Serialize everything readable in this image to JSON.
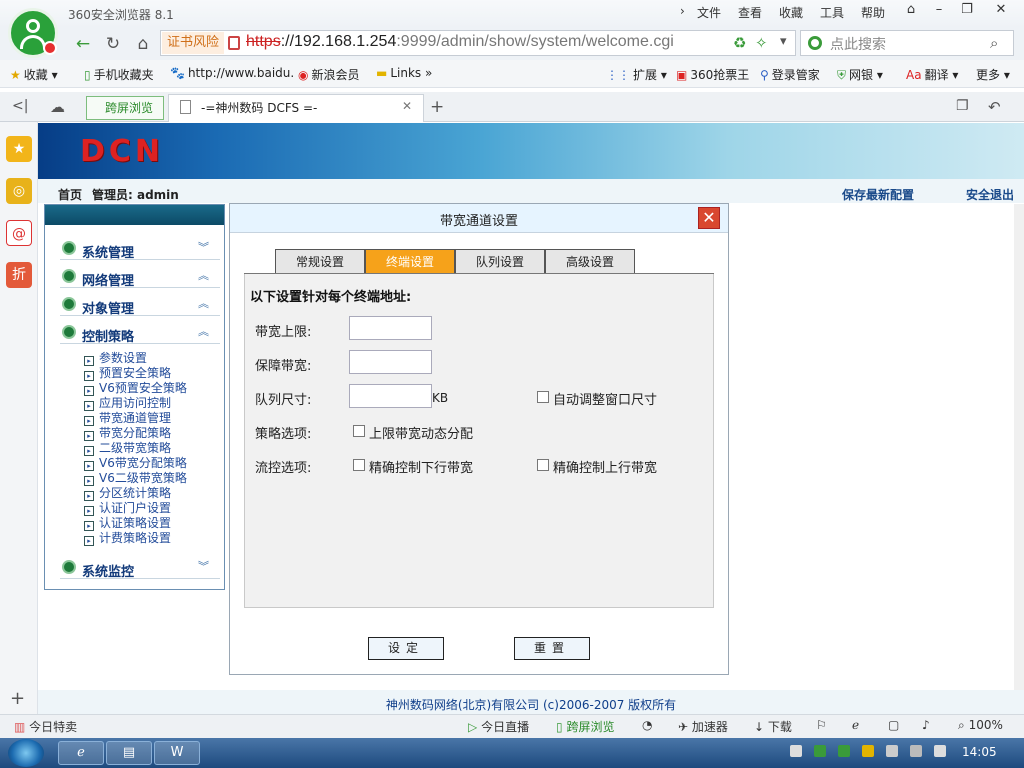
{
  "browser": {
    "app_title": "360安全浏览器 8.1",
    "menu": [
      "文件",
      "查看",
      "收藏",
      "工具",
      "帮助"
    ],
    "cert_warning": "证书风险",
    "url_scheme": "https",
    "url_host": "://192.168.1.254",
    "url_path": ":9999/admin/show/system/welcome.cgi",
    "search_placeholder": "点此搜索",
    "bookmarks": [
      "收藏",
      "手机收藏夹",
      "http://www.baidu.",
      "新浪会员",
      "Links"
    ],
    "toolbar_right": [
      "扩展",
      "360抢票王",
      "登录管家",
      "网银",
      "翻译",
      "更多"
    ],
    "tabs": {
      "split_view": "跨屏浏览",
      "active_tab": "-=神州数码 DCFS =-"
    }
  },
  "page": {
    "banner_logo": "DCN",
    "home": "首页",
    "admin_label": "管理员: admin",
    "save_config": "保存最新配置",
    "logout": "安全退出",
    "footer": "神州数码网络(北京)有限公司 (c)2006-2007 版权所有"
  },
  "sidebar": {
    "sections": [
      {
        "label": "系统管理",
        "chevron": "︾"
      },
      {
        "label": "网络管理",
        "chevron": "︽"
      },
      {
        "label": "对象管理",
        "chevron": "︽"
      },
      {
        "label": "控制策略",
        "chevron": "︽"
      }
    ],
    "items": [
      "参数设置",
      "预置安全策略",
      "V6预置安全策略",
      "应用访问控制",
      "带宽通道管理",
      "带宽分配策略",
      "二级带宽策略",
      "V6带宽分配策略",
      "V6二级带宽策略",
      "分区统计策略",
      "认证门户设置",
      "认证策略设置",
      "计费策略设置"
    ],
    "last_section": {
      "label": "系统监控",
      "chevron": "︾"
    }
  },
  "dialog": {
    "title": "带宽通道设置",
    "close": "✕",
    "tabs": [
      "常规设置",
      "终端设置",
      "队列设置",
      "高级设置"
    ],
    "active_tab": "终端设置",
    "intro": "以下设置针对每个终端地址:",
    "fields": {
      "bw_limit_label": "带宽上限:",
      "bw_guarantee_label": "保障带宽:",
      "queue_size_label": "队列尺寸:",
      "queue_unit": "KB",
      "auto_window": "自动调整窗口尺寸",
      "policy_label": "策略选项:",
      "dynamic_alloc": "上限带宽动态分配",
      "flow_label": "流控选项:",
      "precise_down": "精确控制下行带宽",
      "precise_up": "精确控制上行带宽"
    },
    "buttons": {
      "set": "设定",
      "reset": "重置"
    }
  },
  "statusbar": {
    "left": "今日特卖",
    "items": [
      "今日直播",
      "跨屏浏览",
      "加速器",
      "下载"
    ],
    "zoom": "100%"
  },
  "taskbar": {
    "clock": "14:05"
  },
  "colors": {
    "accent_tab": "#f6a21a",
    "nav_link": "#1a4a8a",
    "sidebar_link": "#234c9a"
  }
}
